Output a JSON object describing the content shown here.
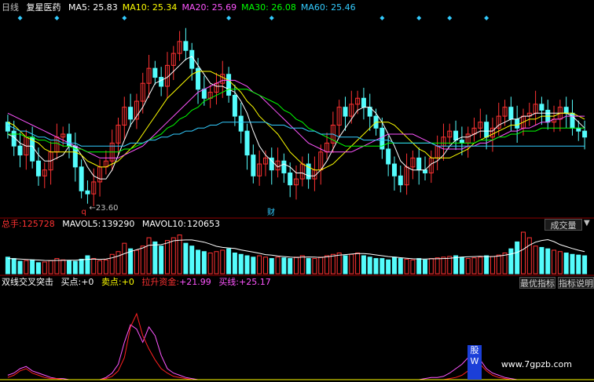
{
  "header": {
    "period": "日线",
    "stock_name": "复星医药",
    "ma": [
      {
        "label": "MA5:",
        "value": "25.83",
        "color": "#ffffff"
      },
      {
        "label": "MA10:",
        "value": "25.34",
        "color": "#ffff00"
      },
      {
        "label": "MA20:",
        "value": "25.69",
        "color": "#ff55ff"
      },
      {
        "label": "MA30:",
        "value": "26.08",
        "color": "#00ff00"
      },
      {
        "label": "MA60:",
        "value": "25.46",
        "color": "#33ccff"
      }
    ]
  },
  "price_panel": {
    "low_label": "23.60",
    "q_marker": "q",
    "cai_marker": "财"
  },
  "volume_panel": {
    "total_label": "总手:",
    "total_value": "125728",
    "mavol5_label": "MAVOL5:",
    "mavol5_value": "139290",
    "mavol10_label": "MAVOL10:",
    "mavol10_value": "120653",
    "button": "成交量"
  },
  "indicator_panel": {
    "name": "双线交叉突击",
    "buy_label": "买点:",
    "buy_value": "+0",
    "sell_label": "卖点:",
    "sell_value": "+0",
    "fund_label": "拉升资金:",
    "fund_value": "+21.99",
    "line_label": "买线:",
    "line_value": "+25.17",
    "button1": "最优指标",
    "button2": "指标说明"
  },
  "watermark": "www.7gpzb.com",
  "stamp_text": "股W",
  "colors": {
    "up": "#ff3232",
    "down": "#54fcfc",
    "ma5": "#ffffff",
    "ma10": "#ffff00",
    "ma20": "#ff55ff",
    "ma30": "#00ff00",
    "ma60": "#33ccff",
    "diamond": "#33ccff"
  },
  "chart_data": {
    "type": "candlestick",
    "n": 95,
    "closes": [
      26.0,
      25.5,
      25.2,
      25.8,
      25.0,
      24.5,
      24.7,
      25.3,
      25.8,
      25.9,
      25.5,
      24.8,
      24.0,
      23.9,
      24.3,
      24.8,
      25.0,
      25.6,
      26.2,
      26.8,
      26.4,
      27.0,
      27.6,
      28.1,
      27.8,
      27.5,
      28.2,
      28.6,
      29.0,
      28.7,
      28.1,
      27.4,
      27.1,
      27.3,
      27.6,
      27.9,
      27.2,
      26.5,
      26.0,
      25.2,
      24.5,
      24.9,
      25.1,
      24.7,
      25.0,
      24.6,
      24.2,
      24.4,
      24.9,
      24.4,
      24.7,
      25.3,
      25.6,
      26.2,
      26.8,
      26.5,
      26.9,
      27.1,
      26.8,
      26.5,
      26.1,
      25.4,
      24.9,
      24.5,
      24.2,
      24.8,
      25.1,
      24.7,
      24.6,
      25.1,
      25.5,
      25.8,
      26.0,
      25.7,
      25.6,
      25.9,
      26.1,
      26.3,
      25.8,
      26.1,
      26.5,
      26.8,
      26.4,
      26.1,
      26.5,
      26.6,
      26.9,
      26.7,
      26.3,
      26.4,
      26.8,
      26.6,
      26.1,
      26.0,
      25.8
    ],
    "opens": [
      26.3,
      26.0,
      25.5,
      25.2,
      25.8,
      25.0,
      24.5,
      24.7,
      25.3,
      25.8,
      25.9,
      25.5,
      24.8,
      24.0,
      23.9,
      24.3,
      24.8,
      25.0,
      25.6,
      26.2,
      26.8,
      26.4,
      27.0,
      27.6,
      28.1,
      27.8,
      27.5,
      28.2,
      28.6,
      29.0,
      28.7,
      28.1,
      27.4,
      27.1,
      27.3,
      27.6,
      27.9,
      27.2,
      26.5,
      26.0,
      25.2,
      24.5,
      24.9,
      25.1,
      24.7,
      25.0,
      24.6,
      24.2,
      24.4,
      24.9,
      24.4,
      24.7,
      25.3,
      25.6,
      26.2,
      26.8,
      26.5,
      26.9,
      27.1,
      26.8,
      26.5,
      26.1,
      25.4,
      24.9,
      24.5,
      24.2,
      24.8,
      25.1,
      24.7,
      24.6,
      25.1,
      25.5,
      25.8,
      26.0,
      25.7,
      25.6,
      25.9,
      26.1,
      26.3,
      25.8,
      26.1,
      26.5,
      26.8,
      26.4,
      26.1,
      26.5,
      26.6,
      26.9,
      26.7,
      26.3,
      26.4,
      26.8,
      26.6,
      26.1,
      26.0
    ],
    "ylim": [
      23.3,
      29.6
    ],
    "ma": {
      "MA5": [
        25.9,
        25.8,
        25.6,
        25.5,
        25.5,
        25.2,
        25.0,
        25.0,
        25.1,
        25.2,
        25.5,
        25.5,
        25.2,
        24.8,
        24.5,
        24.4,
        24.4,
        24.7,
        25.2,
        25.7,
        26.2,
        26.5,
        26.8,
        27.2,
        27.6,
        27.7,
        27.8,
        28.0,
        28.2,
        28.4,
        28.5,
        28.2,
        27.9,
        27.6,
        27.5,
        27.5,
        27.4,
        27.3,
        27.0,
        26.6,
        26.0,
        25.5,
        25.2,
        25.0,
        24.8,
        24.9,
        24.8,
        24.6,
        24.6,
        24.5,
        24.5,
        24.7,
        25.0,
        25.4,
        25.8,
        26.1,
        26.4,
        26.7,
        26.8,
        26.8,
        26.6,
        26.3,
        25.9,
        25.5,
        25.0,
        24.8,
        24.7,
        24.7,
        24.7,
        24.9,
        25.0,
        25.2,
        25.5,
        25.7,
        25.8,
        25.8,
        25.9,
        26.0,
        26.0,
        26.0,
        26.2,
        26.3,
        26.4,
        26.4,
        26.5,
        26.5,
        26.6,
        26.6,
        26.6,
        26.6,
        26.6,
        26.6,
        26.5,
        26.3,
        26.1
      ],
      "MA10": [
        26.3,
        26.2,
        26.0,
        25.8,
        25.7,
        25.6,
        25.4,
        25.3,
        25.3,
        25.3,
        25.3,
        25.3,
        25.2,
        25.0,
        24.9,
        24.8,
        24.8,
        24.9,
        25.0,
        25.2,
        25.4,
        25.6,
        25.9,
        26.2,
        26.5,
        26.8,
        27.1,
        27.3,
        27.5,
        27.7,
        27.9,
        28.0,
        28.0,
        28.0,
        27.9,
        27.8,
        27.7,
        27.5,
        27.3,
        27.0,
        26.8,
        26.5,
        26.3,
        26.1,
        25.9,
        25.6,
        25.3,
        25.1,
        24.9,
        24.8,
        24.7,
        24.7,
        24.8,
        24.9,
        25.1,
        25.3,
        25.5,
        25.7,
        25.9,
        26.1,
        26.3,
        26.3,
        26.3,
        26.2,
        26.0,
        25.8,
        25.6,
        25.4,
        25.3,
        25.1,
        25.1,
        25.1,
        25.1,
        25.2,
        25.3,
        25.4,
        25.6,
        25.7,
        25.8,
        25.9,
        26.0,
        26.1,
        26.2,
        26.2,
        26.3,
        26.4,
        26.4,
        26.5,
        26.5,
        26.5,
        26.6,
        26.6,
        26.6,
        26.5,
        26.4
      ],
      "MA20": [
        26.6,
        26.5,
        26.4,
        26.3,
        26.2,
        26.1,
        26.0,
        25.9,
        25.8,
        25.7,
        25.6,
        25.5,
        25.4,
        25.3,
        25.2,
        25.1,
        25.1,
        25.1,
        25.1,
        25.2,
        25.3,
        25.4,
        25.5,
        25.7,
        25.9,
        26.1,
        26.3,
        26.5,
        26.7,
        26.9,
        27.1,
        27.3,
        27.4,
        27.5,
        27.6,
        27.7,
        27.7,
        27.7,
        27.6,
        27.5,
        27.3,
        27.2,
        27.0,
        26.8,
        26.6,
        26.4,
        26.2,
        26.0,
        25.8,
        25.6,
        25.5,
        25.4,
        25.3,
        25.3,
        25.3,
        25.3,
        25.3,
        25.4,
        25.5,
        25.6,
        25.7,
        25.8,
        25.9,
        25.9,
        25.9,
        25.9,
        25.9,
        25.8,
        25.7,
        25.6,
        25.5,
        25.4,
        25.4,
        25.4,
        25.4,
        25.5,
        25.5,
        25.6,
        25.6,
        25.7,
        25.8,
        25.9,
        26.0,
        26.0,
        26.1,
        26.1,
        26.2,
        26.3,
        26.3,
        26.4,
        26.4,
        26.5,
        26.5,
        26.5,
        26.5
      ],
      "MA30": [
        25.9,
        25.9,
        25.9,
        25.8,
        25.8,
        25.7,
        25.7,
        25.6,
        25.6,
        25.5,
        25.5,
        25.4,
        25.4,
        25.3,
        25.3,
        25.3,
        25.3,
        25.3,
        25.3,
        25.4,
        25.4,
        25.5,
        25.6,
        25.7,
        25.8,
        25.9,
        26.1,
        26.2,
        26.4,
        26.5,
        26.7,
        26.8,
        27.0,
        27.1,
        27.2,
        27.3,
        27.4,
        27.4,
        27.4,
        27.4,
        27.3,
        27.2,
        27.1,
        27.0,
        26.9,
        26.7,
        26.6,
        26.4,
        26.3,
        26.1,
        26.0,
        25.9,
        25.8,
        25.7,
        25.6,
        25.5,
        25.5,
        25.5,
        25.5,
        25.5,
        25.5,
        25.5,
        25.6,
        25.6,
        25.6,
        25.6,
        25.6,
        25.6,
        25.6,
        25.6,
        25.6,
        25.6,
        25.6,
        25.6,
        25.6,
        25.6,
        25.6,
        25.7,
        25.7,
        25.7,
        25.8,
        25.8,
        25.9,
        25.9,
        26.0,
        26.0,
        26.0,
        26.1,
        26.1,
        26.1,
        26.1,
        26.1,
        26.1,
        26.1,
        26.1
      ],
      "MA60": [
        26.2,
        26.1,
        26.0,
        26.0,
        25.9,
        25.8,
        25.8,
        25.7,
        25.7,
        25.6,
        25.6,
        25.6,
        25.5,
        25.5,
        25.5,
        25.5,
        25.5,
        25.5,
        25.5,
        25.5,
        25.6,
        25.6,
        25.6,
        25.7,
        25.7,
        25.8,
        25.8,
        25.9,
        25.9,
        26.0,
        26.0,
        26.1,
        26.1,
        26.2,
        26.2,
        26.3,
        26.3,
        26.3,
        26.3,
        26.3,
        26.3,
        26.3,
        26.3,
        26.2,
        26.2,
        26.2,
        26.1,
        26.1,
        26.1,
        26.0,
        26.0,
        25.9,
        25.9,
        25.9,
        25.8,
        25.8,
        25.8,
        25.8,
        25.7,
        25.7,
        25.7,
        25.7,
        25.7,
        25.6,
        25.6,
        25.6,
        25.6,
        25.6,
        25.6,
        25.6,
        25.5,
        25.5,
        25.5,
        25.5,
        25.5,
        25.5,
        25.5,
        25.5,
        25.5,
        25.5,
        25.5,
        25.5,
        25.5,
        25.5,
        25.5,
        25.5,
        25.5,
        25.5,
        25.5,
        25.5,
        25.5,
        25.5,
        25.5,
        25.5,
        25.5
      ]
    },
    "diamonds_at": [
      2,
      8,
      19,
      36,
      43,
      61,
      67,
      72,
      78
    ],
    "volume": [
      120,
      110,
      90,
      95,
      100,
      80,
      85,
      95,
      110,
      100,
      95,
      90,
      105,
      130,
      110,
      95,
      100,
      140,
      160,
      220,
      180,
      170,
      200,
      260,
      230,
      200,
      240,
      260,
      280,
      220,
      200,
      170,
      160,
      150,
      160,
      170,
      180,
      150,
      140,
      130,
      120,
      130,
      120,
      110,
      120,
      115,
      110,
      120,
      130,
      110,
      110,
      120,
      130,
      140,
      150,
      130,
      140,
      150,
      130,
      120,
      110,
      110,
      100,
      120,
      110,
      105,
      100,
      110,
      100,
      110,
      115,
      120,
      125,
      130,
      120,
      110,
      115,
      120,
      130,
      125,
      135,
      150,
      180,
      230,
      300,
      260,
      200,
      190,
      180,
      170,
      160,
      150,
      140,
      135,
      130
    ],
    "volume_ma5": [
      110,
      108,
      106,
      103,
      101,
      99,
      96,
      95,
      96,
      97,
      98,
      98,
      100,
      104,
      106,
      104,
      106,
      115,
      128,
      145,
      160,
      174,
      186,
      206,
      208,
      210,
      222,
      238,
      242,
      244,
      244,
      236,
      228,
      214,
      198,
      190,
      186,
      182,
      172,
      164,
      156,
      148,
      138,
      134,
      128,
      124,
      120,
      118,
      120,
      121,
      120,
      118,
      122,
      128,
      134,
      138,
      142,
      146,
      146,
      142,
      136,
      130,
      124,
      120,
      116,
      112,
      108,
      106,
      106,
      108,
      108,
      110,
      112,
      116,
      120,
      122,
      124,
      126,
      124,
      124,
      128,
      134,
      142,
      154,
      176,
      206,
      228,
      240,
      246,
      232,
      210,
      196,
      182,
      170,
      160
    ],
    "indicator": {
      "red": [
        2,
        4,
        8,
        10,
        6,
        4,
        2,
        1,
        1,
        0,
        0,
        0,
        0,
        0,
        0,
        0,
        1,
        3,
        8,
        20,
        48,
        60,
        40,
        28,
        18,
        10,
        6,
        3,
        2,
        1,
        0,
        0,
        0,
        0,
        0,
        0,
        0,
        0,
        0,
        0,
        0,
        0,
        0,
        0,
        0,
        0,
        0,
        0,
        0,
        0,
        0,
        0,
        0,
        0,
        0,
        0,
        0,
        0,
        0,
        0,
        0,
        0,
        0,
        0,
        0,
        0,
        0,
        0,
        0,
        0,
        0,
        0,
        1,
        2,
        4,
        8,
        10,
        14,
        8,
        4,
        2,
        1,
        0,
        0,
        0,
        0,
        0,
        0,
        0,
        0,
        0,
        0,
        0,
        0,
        0
      ],
      "pink": [
        4,
        6,
        10,
        12,
        8,
        6,
        4,
        2,
        1,
        1,
        0,
        0,
        0,
        0,
        0,
        0,
        2,
        6,
        14,
        34,
        50,
        46,
        34,
        48,
        40,
        22,
        10,
        6,
        4,
        2,
        1,
        0,
        0,
        0,
        0,
        0,
        0,
        0,
        0,
        0,
        0,
        0,
        0,
        0,
        0,
        0,
        0,
        0,
        0,
        0,
        0,
        0,
        0,
        0,
        0,
        0,
        0,
        0,
        0,
        0,
        0,
        0,
        0,
        0,
        0,
        0,
        0,
        0,
        1,
        2,
        2,
        3,
        6,
        10,
        14,
        20,
        24,
        18,
        10,
        6,
        4,
        2,
        1,
        0,
        0,
        0,
        0,
        0,
        0,
        0,
        0,
        0,
        0,
        0,
        0
      ],
      "ylim": [
        0,
        80
      ]
    }
  }
}
